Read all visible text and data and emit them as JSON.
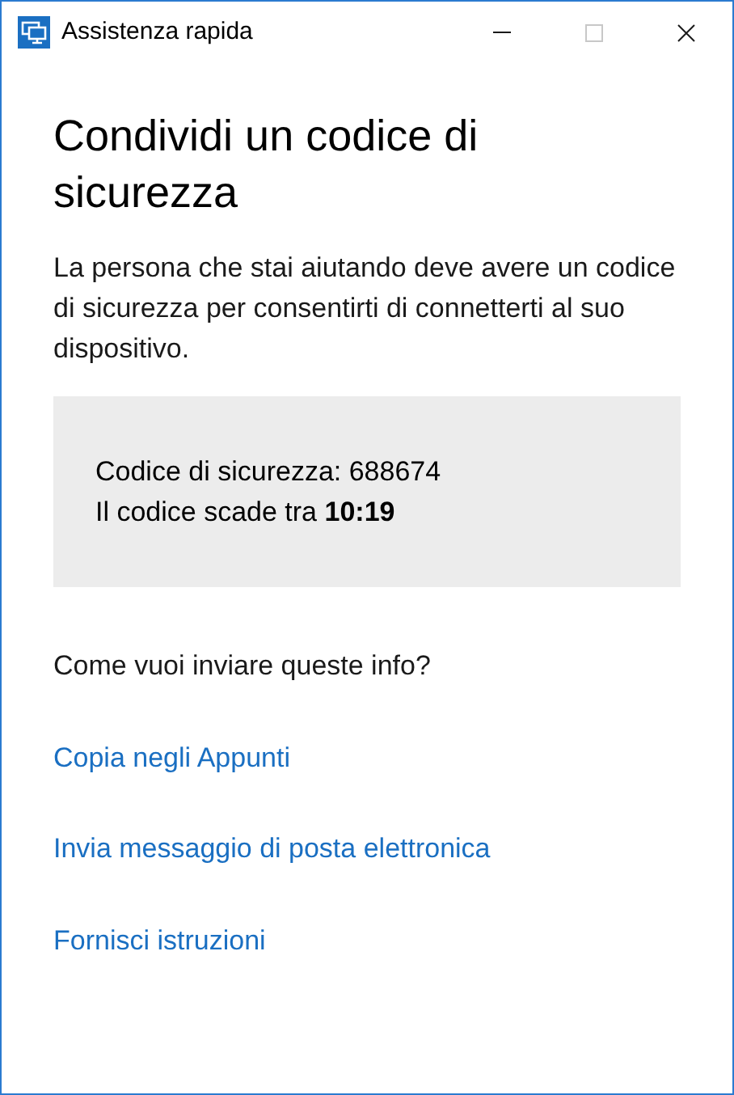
{
  "window": {
    "title": "Assistenza rapida",
    "controls": [
      {
        "kind": "minimize",
        "disabled": false
      },
      {
        "kind": "maximize",
        "disabled": true
      },
      {
        "kind": "close",
        "disabled": false
      }
    ]
  },
  "heading": "Condividi un codice di sicurezza",
  "description": "La persona che stai aiutando deve avere un codice di sicurezza per consentirti di connetterti al suo dispositivo.",
  "code_panel": {
    "code_line": "Codice di sicurezza: 688674",
    "expiry_line": "Il codice scade tra **10:19**"
  },
  "question": "Come vuoi inviare queste info?",
  "links": [
    "Copia negli Appunti",
    "Invia messaggio di posta elettronica",
    "Fornisci istruzioni"
  ]
}
